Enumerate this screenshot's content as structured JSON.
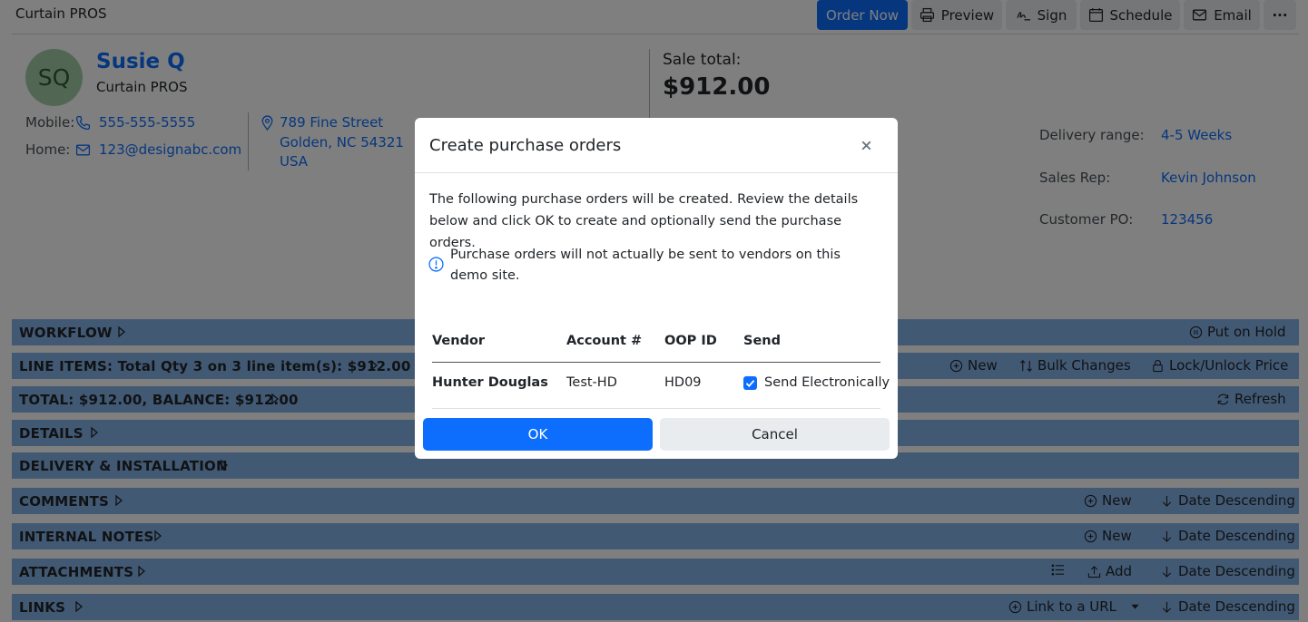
{
  "app": {
    "brand": "Curtain PROS"
  },
  "toolbar": {
    "order_now": "Order Now",
    "preview": "Preview",
    "sign": "Sign",
    "schedule": "Schedule",
    "email": "Email",
    "more": "···"
  },
  "customer": {
    "initials": "SQ",
    "name": "Susie Q",
    "company": "Curtain PROS",
    "mobile_label": "Mobile:",
    "mobile": "555-555-5555",
    "home_label": "Home:",
    "email": "123@designabc.com",
    "address": [
      "789 Fine Street",
      "Golden, NC 54321",
      "USA"
    ]
  },
  "sale": {
    "label": "Sale total:",
    "total": "$912.00"
  },
  "details_kv": [
    {
      "label": "Delivery range:",
      "value": "4-5 Weeks"
    },
    {
      "label": "Sales Rep:",
      "value": "Kevin Johnson"
    },
    {
      "label": "Customer PO:",
      "value": "123456"
    }
  ],
  "sections": {
    "workflow": {
      "title": "WORKFLOW",
      "action": "Put on Hold"
    },
    "line_items": {
      "title": "LINE ITEMS: Total Qty 3 on 3 line item(s): $912.00",
      "new": "New",
      "bulk": "Bulk Changes",
      "lock": "Lock/Unlock Price"
    },
    "total": {
      "title": "TOTAL: $912.00, BALANCE: $912.00",
      "refresh": "Refresh"
    },
    "details": {
      "title": "DETAILS"
    },
    "delivery": {
      "title": "DELIVERY & INSTALLATION"
    },
    "comments": {
      "title": "COMMENTS",
      "new": "New",
      "sort": "Date Descending"
    },
    "internal_notes": {
      "title": "INTERNAL NOTES",
      "new": "New",
      "sort": "Date Descending"
    },
    "attachments": {
      "title": "ATTACHMENTS",
      "add": "Add",
      "sort": "Date Descending"
    },
    "links": {
      "title": "LINKS",
      "link": "Link to a URL",
      "sort": "Date Descending"
    }
  },
  "modal": {
    "title": "Create purchase orders",
    "description": "The following purchase orders will be created. Review the details below and click OK to create and optionally send the purchase orders.",
    "info": "Purchase orders will not actually be sent to vendors on this demo site.",
    "columns": [
      "Vendor",
      "Account #",
      "OOP ID",
      "Send"
    ],
    "rows": [
      {
        "vendor": "Hunter Douglas",
        "account": "Test-HD",
        "oop_id": "HD09",
        "send_label": "Send Electronically",
        "send_checked": true
      }
    ],
    "ok": "OK",
    "cancel": "Cancel"
  }
}
